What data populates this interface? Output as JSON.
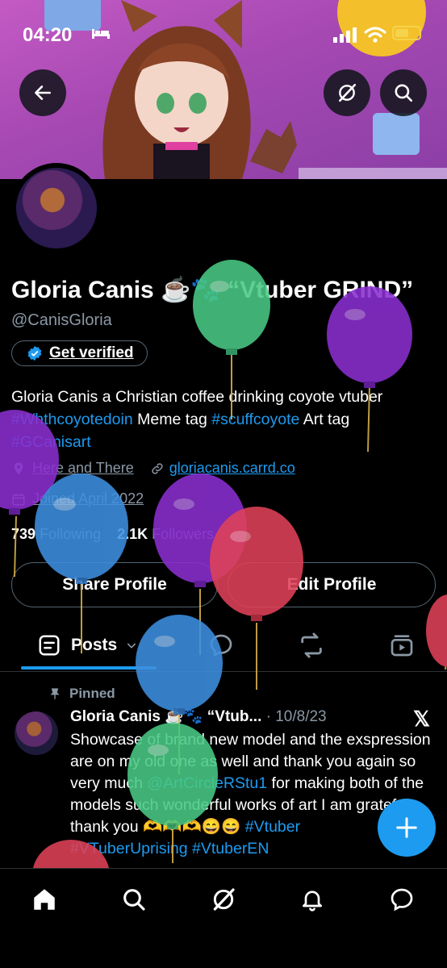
{
  "status_bar": {
    "time": "04:20"
  },
  "profile": {
    "name": "Gloria Canis ☕🐾 “Vtuber GRIND”",
    "handle": "@CanisGloria",
    "verify_label": "Get verified",
    "bio_text": "Gloria Canis a Christian coffee drinking coyote vtuber",
    "bio_tag1": "#Whthcoyotedoin",
    "bio_mid": " Meme tag ",
    "bio_tag2": "#scuffcoyote",
    "bio_art": " Art tag",
    "bio_tag3": "#GCanisart",
    "location": "Here and There",
    "link": "gloriacanis.carrd.co",
    "joined": "Joined April 2022",
    "following_count": "739",
    "following_label": "Following",
    "followers_count": "2.1K",
    "followers_label": "Followers",
    "share_button": "Share Profile",
    "edit_button": "Edit Profile"
  },
  "tabs": {
    "posts": "Posts"
  },
  "tweet": {
    "pinned_label": "Pinned",
    "author": "Gloria Canis ☕🐾 “Vtub...",
    "date": "· 10/8/23",
    "text1": "Showcase of brand new model and the exspression are on my old one as well and thank you again so very much ",
    "mention": "@ArtCircleRStu1",
    "text2": " for making both of the models such wonderful works of art I am grateful thank you 🫶🫶🫶😄😄 ",
    "tag_vtuber": "#Vtuber",
    "tags_line": "#VTuberUprising #VtuberEN"
  },
  "icons": [
    "back-arrow-icon",
    "grok-icon",
    "search-icon",
    "verified-badge-icon",
    "location-icon",
    "link-icon",
    "calendar-icon",
    "posts-icon",
    "reply-icon",
    "repost-icon",
    "media-icon",
    "pin-icon",
    "x-logo-icon",
    "compose-plus-icon",
    "home-icon",
    "explore-icon",
    "grok-nav-icon",
    "notifications-icon",
    "messages-icon"
  ],
  "colors": {
    "accent": "#1d9bf0",
    "background": "#000000",
    "muted": "#8b98a5"
  }
}
